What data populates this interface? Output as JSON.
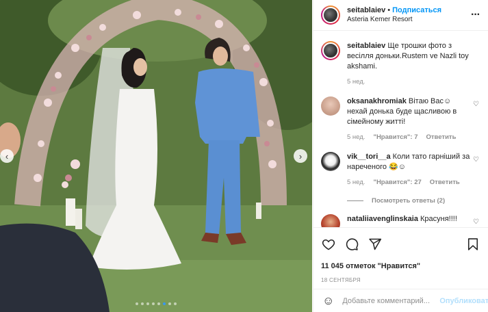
{
  "photo": {
    "prev_icon": "chevron-left-icon",
    "next_icon": "chevron-right-icon",
    "slides_count": 8,
    "active_slide": 6
  },
  "header": {
    "username": "seitablaiev",
    "separator": "•",
    "follow_label": "Подписаться",
    "location": "Asteria Kemer Resort",
    "more_icon": "more-icon"
  },
  "caption": {
    "username": "seitablaiev",
    "text": "Ще трошки фото з весілля доньки.Rustem ve Nazli toy akshami.",
    "time": "5 нед."
  },
  "comments": [
    {
      "username": "oksanakhromiak",
      "text": "Вітаю Вас☺ нехай донька буде щасливою в сімейному житті!",
      "time": "5 нед.",
      "likes": "\"Нравится\": 7",
      "reply": "Ответить"
    },
    {
      "username": "vik__tori__a",
      "text": "Коли тато гарніший за нареченого 😂☺",
      "time": "5 нед.",
      "likes": "\"Нравится\": 27",
      "reply": "Ответить"
    },
    {
      "username": "nataliiavenglinskaia",
      "text": "Красуня!!!!",
      "time": "",
      "likes": "",
      "reply": ""
    }
  ],
  "more_replies": "Посмотреть ответы (2)",
  "actions": {
    "like_icon": "heart-icon",
    "comment_icon": "comment-icon",
    "share_icon": "share-icon",
    "save_icon": "bookmark-icon"
  },
  "likes_count": "11 045 отметок \"Нравится\"",
  "date": "18 СЕНТЯБРЯ",
  "add_comment": {
    "placeholder": "Добавьте комментарий...",
    "publish_label": "Опубликовать",
    "emoji_icon": "emoji-icon"
  },
  "colors": {
    "accent": "#0095f6",
    "publish_disabled": "#b2dffc",
    "muted": "#8e8e8e"
  }
}
